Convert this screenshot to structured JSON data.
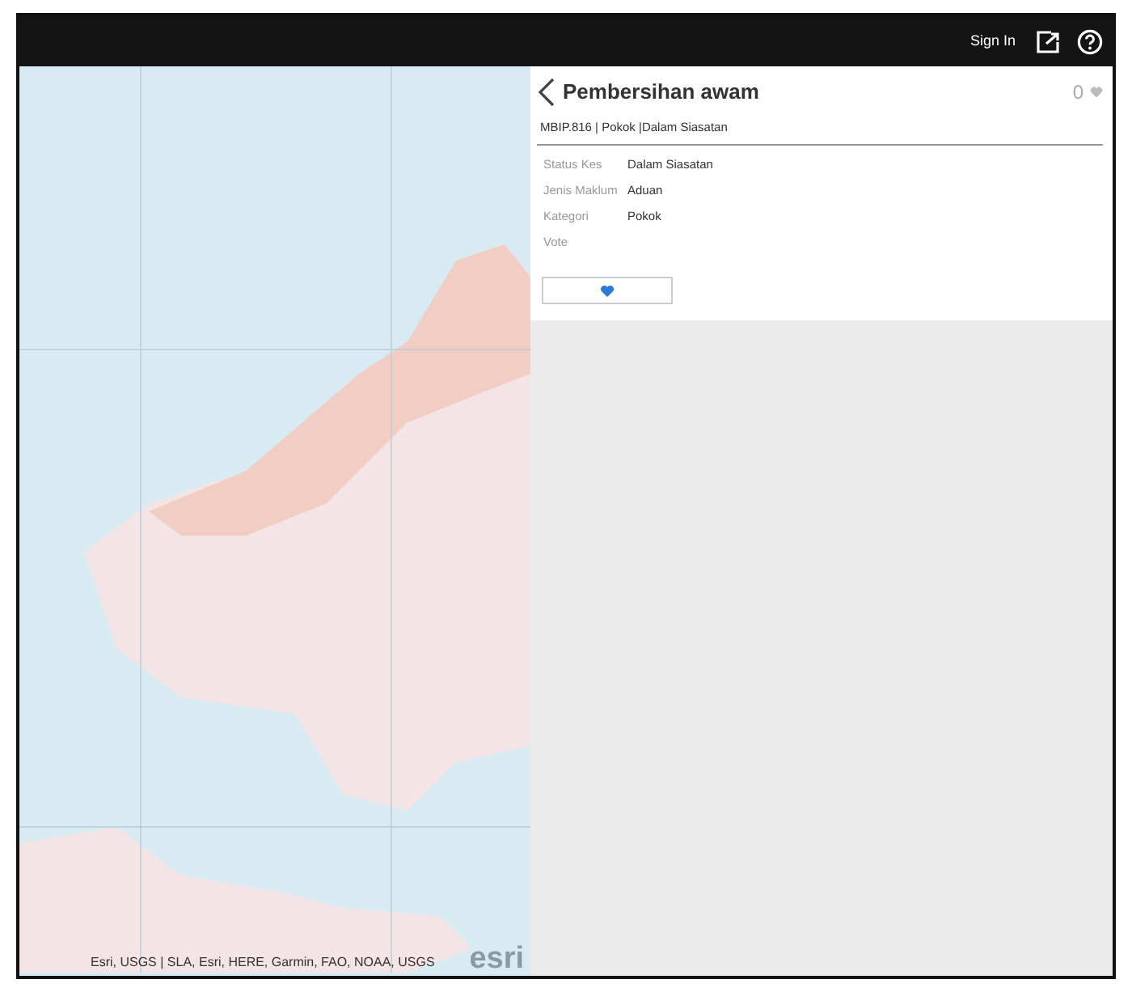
{
  "header": {
    "sign_in": "Sign In"
  },
  "map": {
    "attribution": "Esri, USGS | SLA, Esri, HERE, Garmin, FAO, NOAA, USGS",
    "logo": "esri"
  },
  "panel": {
    "title": "Pembersihan awam",
    "vote_count": "0",
    "subtitle": "MBIP.816 | Pokok |Dalam Siasatan",
    "fields": [
      {
        "label": "Status Kes",
        "value": "Dalam Siasatan"
      },
      {
        "label": "Jenis Maklum",
        "value": "Aduan"
      },
      {
        "label": "Kategori",
        "value": "Pokok"
      },
      {
        "label": "Vote"
      }
    ]
  }
}
